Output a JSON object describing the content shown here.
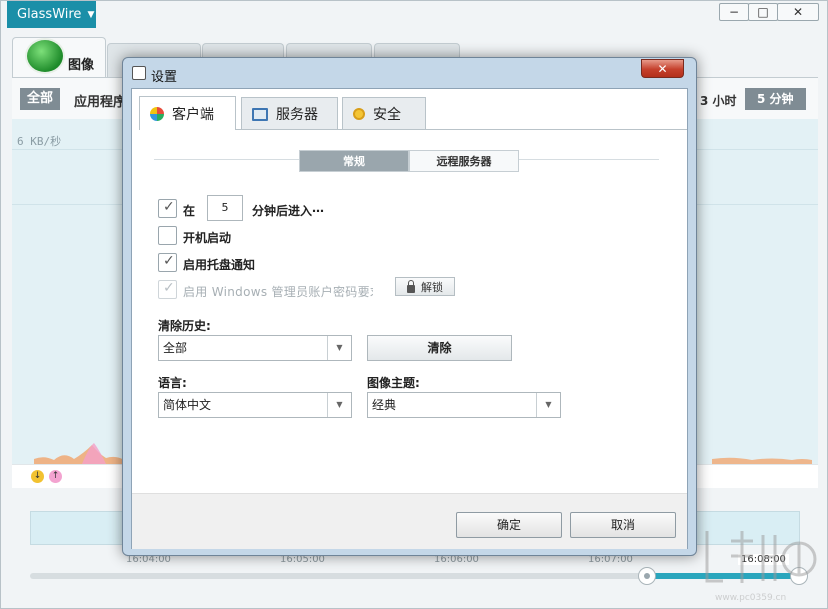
{
  "app": {
    "name": "GlassWire",
    "window_controls": {
      "minimize": "−",
      "maximize": "□",
      "close": "✕"
    }
  },
  "main_tabs": [
    {
      "label": "图像",
      "icon": "glasswire-logo-icon"
    },
    {
      "label": "",
      "icon": "firewall-flame-icon"
    },
    {
      "label": "",
      "icon": "usage-icon"
    },
    {
      "label": "",
      "icon": "network-icon"
    },
    {
      "label": "",
      "icon": "alerts-icon"
    }
  ],
  "filters": {
    "all": "全部",
    "apps": "应用程序"
  },
  "range": {
    "hours": "3 小时",
    "minutes": "5 分钟"
  },
  "graph": {
    "scale_label": "6 KB/秒"
  },
  "timeline": {
    "ticks": [
      "16:04:00",
      "16:05:00",
      "16:06:00",
      "16:07:00"
    ],
    "end_time": "16:08:00"
  },
  "watermark": {
    "url": "www.pc0359.cn"
  },
  "dialog": {
    "title": "设置",
    "close_symbol": "✕",
    "tabs": [
      {
        "label": "客户端",
        "icon": "client-icon"
      },
      {
        "label": "服务器",
        "icon": "server-icon"
      },
      {
        "label": "安全",
        "icon": "security-icon"
      }
    ],
    "subtabs": {
      "general": "常规",
      "remote": "远程服务器"
    },
    "idle": {
      "prefix": "在",
      "minutes": "5",
      "suffix": "分钟后进入⋯",
      "checked": true
    },
    "autostart": {
      "label": "开机启动",
      "checked": false
    },
    "tray_notify": {
      "label": "启用托盘通知",
      "checked": true
    },
    "admin_password": {
      "label": "启用 Windows 管理员账户密码要求",
      "checked": true,
      "disabled": true
    },
    "unlock_label": "解锁",
    "clear_history": {
      "label": "清除历史:",
      "selected": "全部",
      "button": "清除"
    },
    "language": {
      "label": "语言:",
      "selected": "简体中文"
    },
    "theme": {
      "label": "图像主题:",
      "selected": "经典"
    },
    "ok": "确定",
    "cancel": "取消",
    "check_mark": "✓"
  },
  "colors": {
    "brand": "#1b8fa8",
    "accent": "#2aa6bd",
    "close_red": "#c5402c",
    "download_dot": "#f2c230",
    "upload_dot": "#f3a3d0"
  }
}
